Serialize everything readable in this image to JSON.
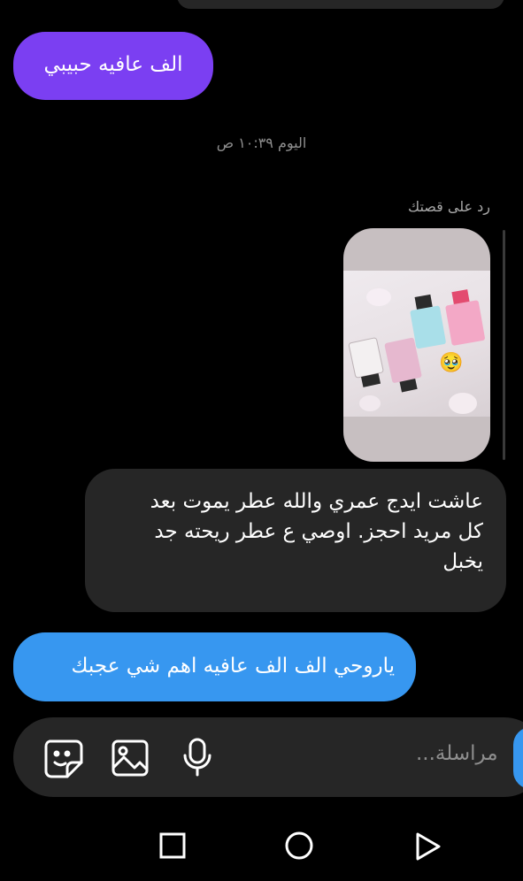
{
  "messages": {
    "first_sent": "الف عافيه حبيبي",
    "timestamp": "اليوم ١٠:٣٩ ص",
    "story_reply_label": "رد على قصتك",
    "received_lines": [
      "عاشت ايدج عمري والله عطر يموت بعد",
      "كل مريد احجز. اوصي ع عطر ريحته جد",
      "يخبل"
    ],
    "second_sent": "ياروحي الف الف عافيه اهم شي عجبك",
    "reaction_emoji": "🥹"
  },
  "composer": {
    "placeholder": "مراسلة..."
  },
  "icons": {
    "sticker": "sticker-icon",
    "gallery": "image-gallery-icon",
    "microphone": "microphone-icon",
    "nav_recent": "square-icon",
    "nav_home": "circle-icon",
    "nav_back": "triangle-back-icon"
  },
  "colors": {
    "purple_bubble": "#7b3ff2",
    "blue_bubble": "#3797f0",
    "received_bubble": "#262626",
    "background": "#000000"
  }
}
